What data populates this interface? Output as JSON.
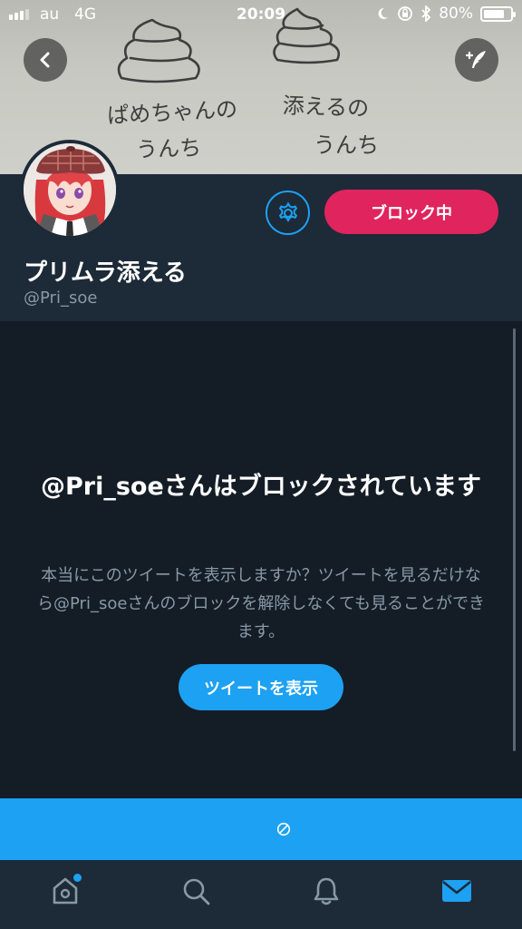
{
  "status_bar": {
    "carrier": "au",
    "network": "4G",
    "time": "20:09",
    "battery": "80%",
    "battery_level": 0.8
  },
  "header_photo": {
    "handwriting_left_1": "ぱめちゃんの",
    "handwriting_left_2": "うんち",
    "handwriting_right_1": "添えるの",
    "handwriting_right_2": "うんち"
  },
  "top_actions": {
    "back_icon": "chevron-left-icon",
    "compose_icon": "compose-feather-icon"
  },
  "profile": {
    "display_name": "プリムラ添える",
    "handle": "@Pri_soe",
    "settings_icon": "gear-icon",
    "block_button_label": "ブロック中"
  },
  "blocked": {
    "title": "@Pri_soeさんはブロックされています",
    "description": "本当にこのツイートを表示しますか？ツイートを見るだけなら@Pri_soeさんのブロックを解除しなくても見ることができます。",
    "button_label": "ツイートを表示"
  },
  "banner": {
    "icon": "block-icon"
  },
  "tab_bar": {
    "tabs": [
      {
        "name": "home",
        "icon": "home-icon",
        "has_badge": true
      },
      {
        "name": "search",
        "icon": "search-icon",
        "has_badge": false
      },
      {
        "name": "notifications",
        "icon": "bell-icon",
        "has_badge": false
      },
      {
        "name": "messages",
        "icon": "mail-icon",
        "active": true
      }
    ]
  },
  "colors": {
    "background": "#141d26",
    "panel": "#1d2a38",
    "accent_blue": "#1da1f2",
    "block_red": "#e0245e",
    "secondary_text": "#8899a6"
  }
}
